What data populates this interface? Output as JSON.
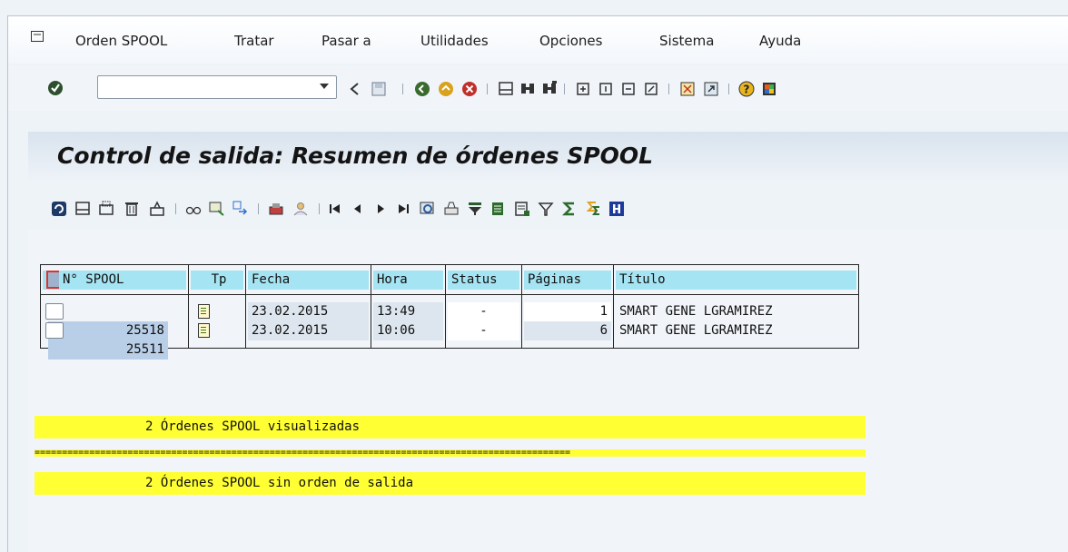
{
  "menu": {
    "items": [
      "Orden SPOOL",
      "Tratar",
      "Pasar a",
      "Utilidades",
      "Opciones",
      "Sistema",
      "Ayuda"
    ]
  },
  "toolbar": {
    "command_value": "",
    "icons": [
      "check-icon",
      "back-icon",
      "save-icon",
      "green-back-icon",
      "exit-icon",
      "cancel-icon",
      "print-icon",
      "find-icon",
      "find-next-icon",
      "first-page-icon",
      "prev-page-icon",
      "next-page-icon",
      "last-page-icon",
      "layout-icon",
      "session-icon",
      "help-icon",
      "customize-icon"
    ]
  },
  "page": {
    "title": "Control de salida: Resumen de órdenes SPOOL"
  },
  "app_toolbar": {
    "icons": [
      "refresh-icon",
      "print-icon",
      "print-options-icon",
      "delete-icon",
      "print-directly-icon",
      "display-icon",
      "details-icon",
      "forward-icon",
      "output-icon",
      "user-icon",
      "first-icon",
      "prev-icon",
      "next-icon",
      "last-icon",
      "zoom-icon",
      "printer-icon",
      "filter-icon",
      "export-icon",
      "export2-icon",
      "funnel-icon",
      "sum-icon",
      "subtotal-icon",
      "info-icon"
    ]
  },
  "table": {
    "headers": [
      "N° SPOOL",
      "Tp",
      "Fecha",
      "Hora",
      "Status",
      "Páginas",
      "Título"
    ],
    "rows": [
      {
        "spool": "25518",
        "fecha": "23.02.2015",
        "hora": "13:49",
        "status": "-",
        "paginas": "1",
        "titulo": "SMART GENE LGRAMIREZ"
      },
      {
        "spool": "25511",
        "fecha": "23.02.2015",
        "hora": "10:06",
        "status": "-",
        "paginas": "6",
        "titulo": "SMART GENE LGRAMIREZ"
      }
    ]
  },
  "summary": {
    "line1": "2 Órdenes SPOOL visualizadas",
    "separator": "==================================================================================================",
    "line2": "2 Órdenes SPOOL sin orden de salida"
  }
}
